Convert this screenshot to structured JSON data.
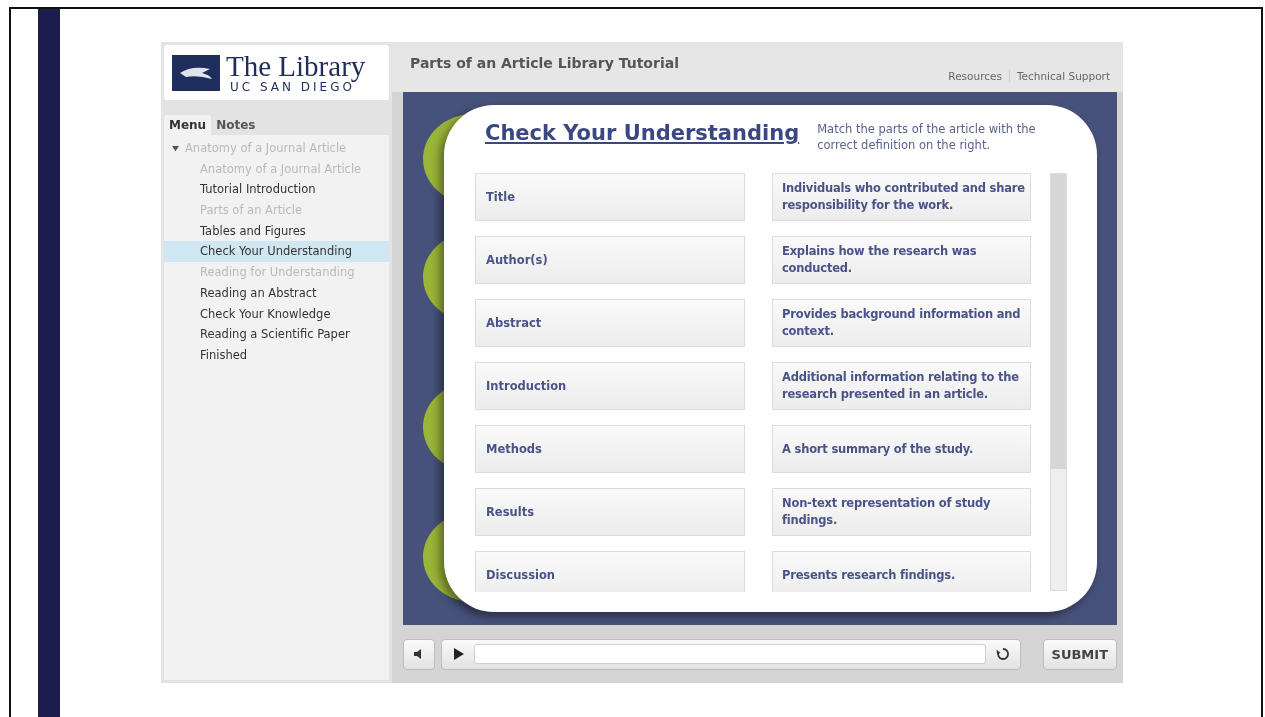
{
  "logo": {
    "title": "The Library",
    "subtitle": "UC SAN DIEGO"
  },
  "tabs": [
    {
      "label": "Menu",
      "selected": true
    },
    {
      "label": "Notes",
      "selected": false
    }
  ],
  "menu": [
    {
      "label": "Anatomy of a Journal Article",
      "dimmed": true,
      "selected": false,
      "expanded": true,
      "children": [
        {
          "label": "Anatomy of a Journal Article",
          "dimmed": true,
          "selected": false
        },
        {
          "label": "Tutorial Introduction",
          "dimmed": false,
          "selected": false
        },
        {
          "label": "Parts of an Article",
          "dimmed": true,
          "selected": false
        },
        {
          "label": "Tables and Figures",
          "dimmed": false,
          "selected": false
        },
        {
          "label": "Check Your Understanding",
          "dimmed": false,
          "selected": true
        },
        {
          "label": "Reading for Understanding",
          "dimmed": true,
          "selected": false
        },
        {
          "label": "Reading an Abstract",
          "dimmed": false,
          "selected": false
        },
        {
          "label": "Check Your Knowledge",
          "dimmed": false,
          "selected": false
        },
        {
          "label": "Reading a Scientific Paper",
          "dimmed": false,
          "selected": false
        },
        {
          "label": "Finished",
          "dimmed": false,
          "selected": false
        }
      ]
    }
  ],
  "header": {
    "title": "Parts of an Article Library Tutorial",
    "links": [
      "Resources",
      "Technical Support"
    ]
  },
  "quiz": {
    "title": "Check Your Understanding",
    "instructions": "Match the parts of the article with the correct definition on the right.",
    "pairs": [
      {
        "term": "Title",
        "definition": "Individuals who contributed and share responsibility for the work."
      },
      {
        "term": "Author(s)",
        "definition": "Explains how the research was conducted."
      },
      {
        "term": "Abstract",
        "definition": "Provides background information and context."
      },
      {
        "term": "Introduction",
        "definition": "Additional information relating to the research presented in an article."
      },
      {
        "term": "Methods",
        "definition": "A short summary of the study."
      },
      {
        "term": "Results",
        "definition": "Non-text representation of study findings."
      },
      {
        "term": "Discussion",
        "definition": "Presents research findings."
      }
    ]
  },
  "controls": {
    "submit": "SUBMIT"
  }
}
